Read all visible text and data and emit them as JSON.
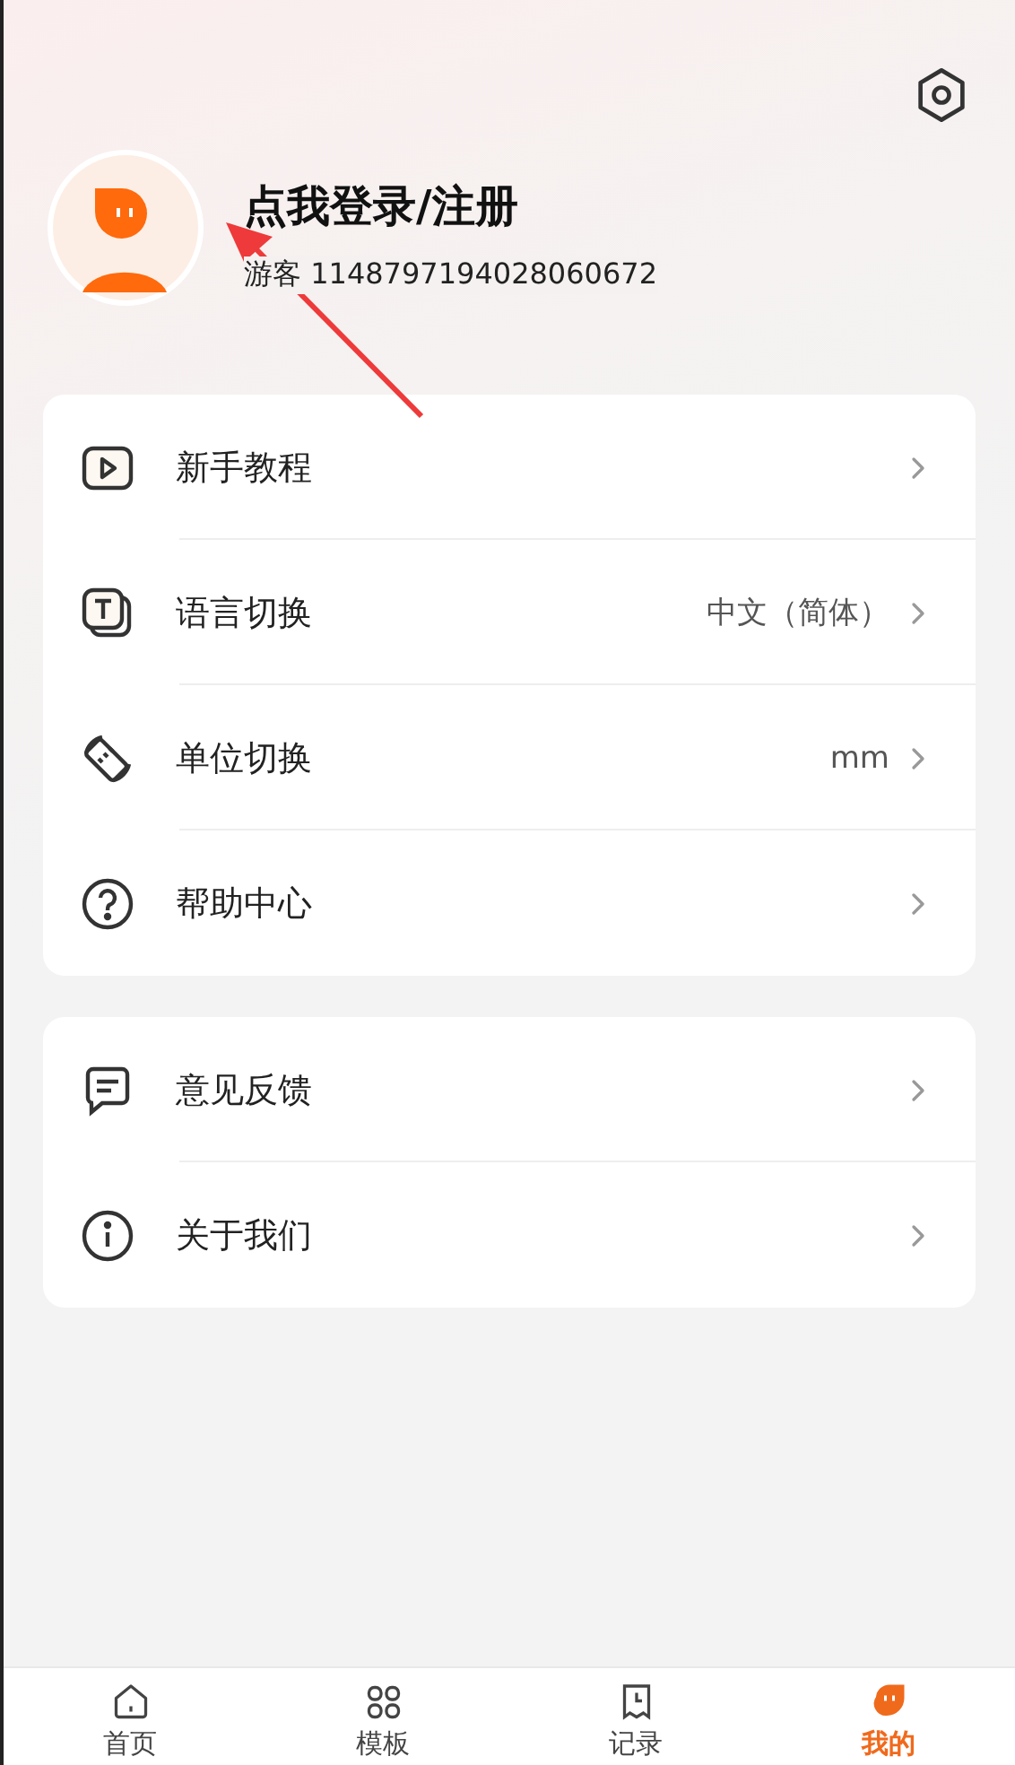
{
  "profile": {
    "title": "点我登录/注册",
    "guest_id": "游客 1148797194028060672"
  },
  "groups": [
    {
      "items": [
        {
          "label": "新手教程"
        },
        {
          "label": "语言切换",
          "value": "中文（简体）"
        },
        {
          "label": "单位切换",
          "value": "mm"
        },
        {
          "label": "帮助中心"
        }
      ]
    },
    {
      "items": [
        {
          "label": "意见反馈"
        },
        {
          "label": "关于我们"
        }
      ]
    }
  ],
  "tabs": [
    {
      "label": "首页",
      "selected": false
    },
    {
      "label": "模板",
      "selected": false
    },
    {
      "label": "记录",
      "selected": false
    },
    {
      "label": "我的",
      "selected": true
    }
  ]
}
